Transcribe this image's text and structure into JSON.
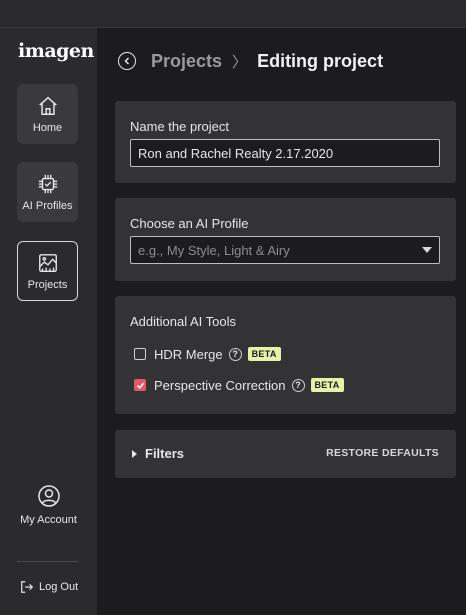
{
  "app": {
    "logo": "imagen"
  },
  "sidebar": {
    "items": [
      {
        "label": "Home",
        "icon": "home-icon"
      },
      {
        "label": "AI Profiles",
        "icon": "chip-icon"
      },
      {
        "label": "Projects",
        "icon": "image-chart-icon"
      }
    ],
    "account_label": "My Account",
    "logout_label": "Log Out"
  },
  "header": {
    "breadcrumb": "Projects",
    "separator": "〉",
    "title": "Editing project"
  },
  "name_card": {
    "label": "Name the project",
    "value": "Ron and Rachel Realty 2.17.2020"
  },
  "profile_card": {
    "label": "Choose an AI Profile",
    "placeholder": "e.g., My Style, Light & Airy"
  },
  "tools_card": {
    "label": "Additional AI Tools",
    "tools": [
      {
        "label": "HDR Merge",
        "checked": false,
        "badge": "BETA",
        "help": "?"
      },
      {
        "label": "Perspective Correction",
        "checked": true,
        "badge": "BETA",
        "help": "?"
      }
    ]
  },
  "filters_card": {
    "label": "Filters",
    "restore_label": "RESTORE DEFAULTS"
  },
  "colors": {
    "accent_check": "#e0596a",
    "beta_badge": "#e6f2a8",
    "background": "#1c1c1e",
    "card": "#333336",
    "sidebar": "#2b2b2e"
  }
}
